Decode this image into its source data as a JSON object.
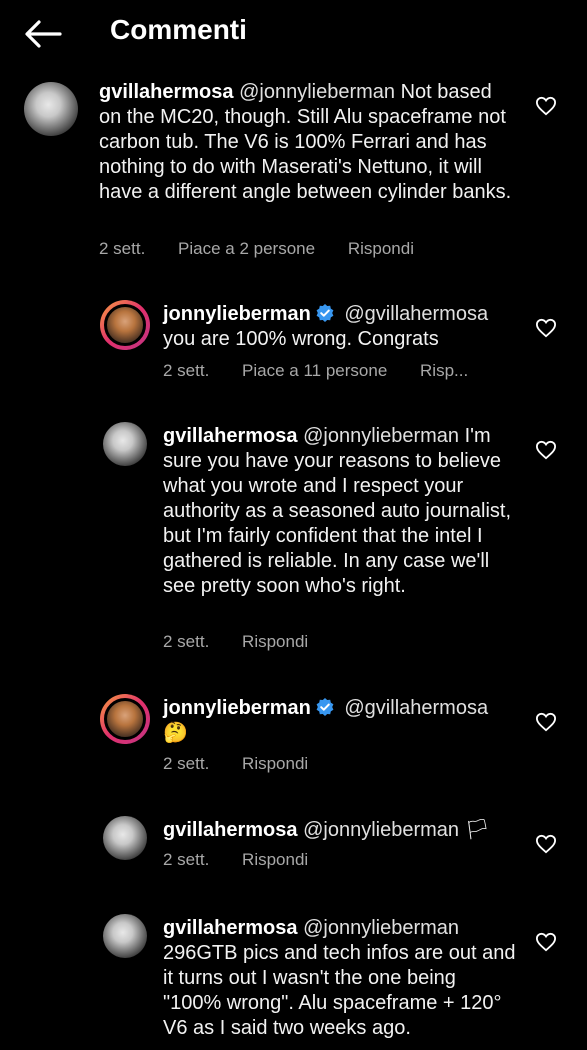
{
  "header": {
    "title": "Commenti",
    "back_icon": "arrow-left-icon"
  },
  "comments": [
    {
      "user": "gvillahermosa",
      "mention": "@jonnylieberman",
      "text": "Not based on the MC20, though. Still Alu spaceframe not carbon tub. The V6 is 100% Ferrari and has nothing to do with Maserati's Nettuno, it will have a different angle between cylinder banks.",
      "time": "2 sett.",
      "likes": "Piace a 2 persone",
      "reply": "Rispondi"
    },
    {
      "user": "jonnylieberman",
      "verified": true,
      "mention": "@gvillahermosa",
      "text": "you are 100% wrong. Congrats",
      "time": "2 sett.",
      "likes": "Piace a 11 persone",
      "reply": "Risp..."
    },
    {
      "user": "gvillahermosa",
      "mention": "@jonnylieberman",
      "text": "I'm sure you have your reasons to believe what you wrote and I respect your authority as a seasoned auto journalist, but I'm fairly confident that the intel I gathered is reliable. In any case we'll see pretty soon who's right.",
      "time": "2 sett.",
      "reply": "Rispondi"
    },
    {
      "user": "jonnylieberman",
      "verified": true,
      "mention": "@gvillahermosa",
      "text": "🤔",
      "time": "2 sett.",
      "reply": "Rispondi"
    },
    {
      "user": "gvillahermosa",
      "mention": "@jonnylieberman",
      "text": "🏳",
      "time": "2 sett.",
      "reply": "Rispondi"
    },
    {
      "user": "gvillahermosa",
      "mention": "@jonnylieberman",
      "text": "296GTB pics and tech infos are out and it turns out I wasn't the one being \"100% wrong\". Alu spaceframe + 120° V6 as I said two weeks ago."
    }
  ]
}
